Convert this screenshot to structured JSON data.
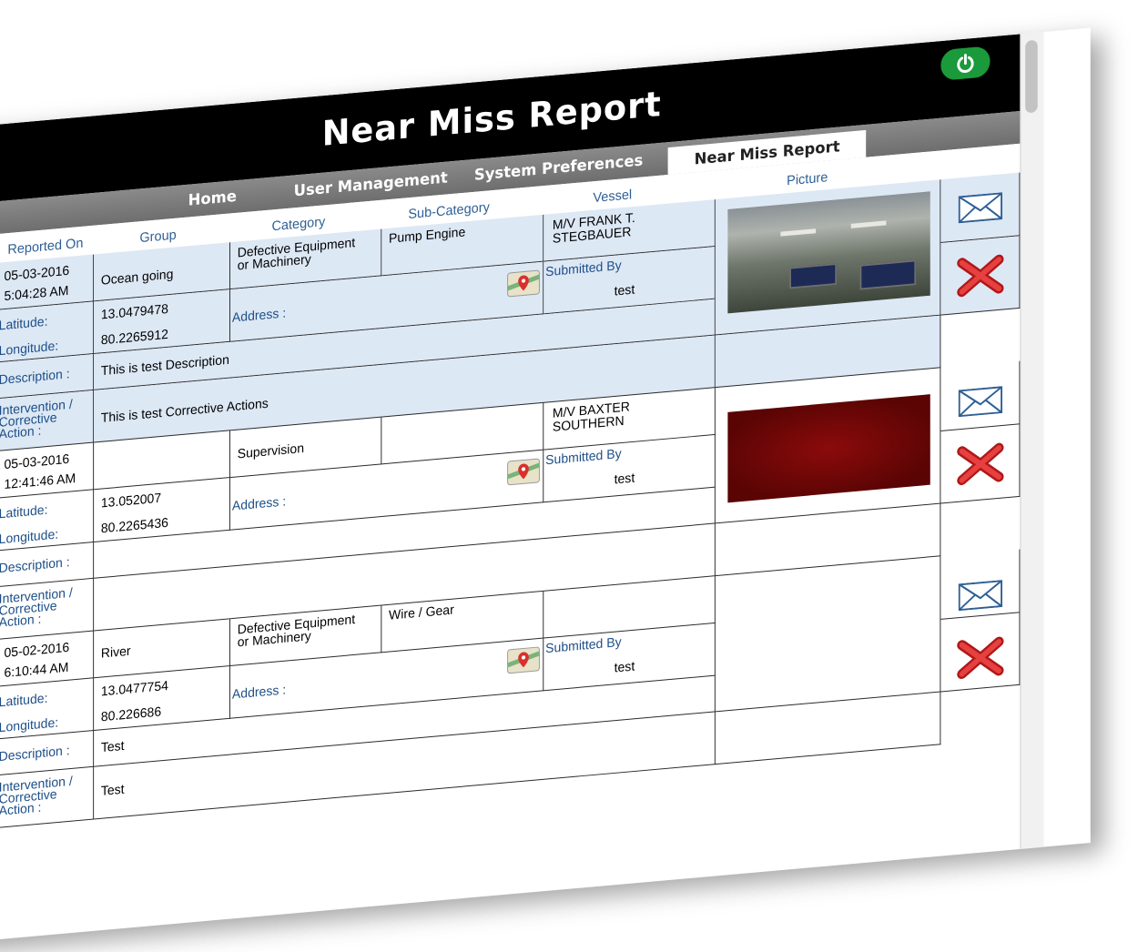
{
  "header": {
    "title": "Near Miss Report"
  },
  "nav": {
    "items": [
      "Home",
      "User Management",
      "System Preferences",
      "Near Miss Report"
    ],
    "active": "Near Miss Report"
  },
  "columns": {
    "reported_on": "Reported On",
    "group": "Group",
    "category": "Category",
    "sub_category": "Sub-Category",
    "vessel": "Vessel",
    "picture": "Picture"
  },
  "labels": {
    "latitude": "Latitude:",
    "longitude": "Longitude:",
    "description": "Description :",
    "intervention": "Intervention / Corrective Action :",
    "address": "Address :",
    "submitted_by": "Submitted By"
  },
  "records": [
    {
      "date": "05-03-2016",
      "time": "5:04:28 AM",
      "group": "Ocean going",
      "category": "Defective Equipment or Machinery",
      "sub_category": "Pump Engine",
      "vessel": "M/V FRANK T. STEGBAUER",
      "latitude": "13.0479478",
      "longitude": "80.2265912",
      "submitted_by": "test",
      "description": "This is test Description",
      "corrective_action": "This is test Corrective Actions",
      "picture": "office-photo"
    },
    {
      "date": "05-03-2016",
      "time": "12:41:46 AM",
      "group": "",
      "category": "Supervision",
      "sub_category": "",
      "vessel": "M/V BAXTER SOUTHERN",
      "latitude": "13.052007",
      "longitude": "80.2265436",
      "submitted_by": "test",
      "description": "",
      "corrective_action": "",
      "picture": "red-photo"
    },
    {
      "date": "05-02-2016",
      "time": "6:10:44 AM",
      "group": "River",
      "category": "Defective Equipment or Machinery",
      "sub_category": "Wire / Gear",
      "vessel": "",
      "latitude": "13.0477754",
      "longitude": "80.226686",
      "submitted_by": "test",
      "description": "Test",
      "corrective_action": "Test",
      "picture": ""
    }
  ],
  "icons": {
    "power": "power-icon",
    "map": "map-pin-icon",
    "email": "envelope-icon",
    "delete": "red-x-icon"
  },
  "colors": {
    "header": "#000000",
    "nav": "#7a7a7a",
    "accent_blue": "#1d4f87",
    "power": "#1a9a3a",
    "row_highlight": "#dde8f5"
  }
}
